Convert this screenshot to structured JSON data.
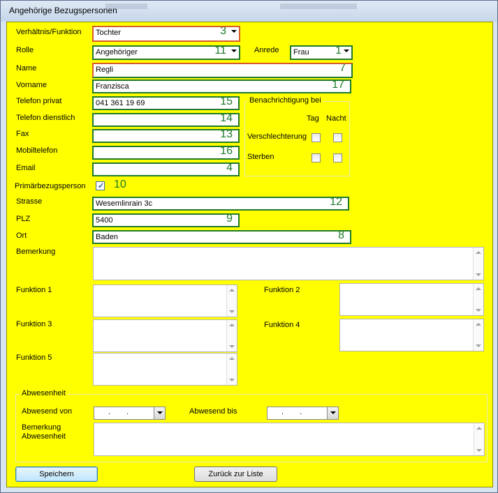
{
  "window": {
    "title": "Angehörige Bezugspersonen"
  },
  "form": {
    "verhaeltnis": {
      "label": "Verhältnis/Funktion",
      "value": "Tochter",
      "num": "3"
    },
    "rolle": {
      "label": "Rolle",
      "value": "Angehöriger",
      "num": "11"
    },
    "anrede": {
      "label": "Anrede",
      "value": "Frau",
      "num": "1"
    },
    "name": {
      "label": "Name",
      "value": "Regli",
      "num": "7"
    },
    "vorname": {
      "label": "Vorname",
      "value": "Franzisca",
      "num": "17"
    },
    "telefon_privat": {
      "label": "Telefon privat",
      "value": "041 361 19 69",
      "num": "15"
    },
    "telefon_dienstlich": {
      "label": "Telefon dienstlich",
      "value": "",
      "num": "14"
    },
    "fax": {
      "label": "Fax",
      "value": "",
      "num": "13"
    },
    "mobiltelefon": {
      "label": "Mobiltelefon",
      "value": "",
      "num": "16"
    },
    "email": {
      "label": "Email",
      "value": "",
      "num": "4"
    },
    "primaer": {
      "label": "Primärbezugsperson",
      "num": "10",
      "checked": true
    },
    "strasse": {
      "label": "Strasse",
      "value": "Wesemlinrain 3c",
      "num": "12"
    },
    "plz": {
      "label": "PLZ",
      "value": "5400",
      "num": "9"
    },
    "ort": {
      "label": "Ort",
      "value": "Baden",
      "num": "8"
    },
    "bemerkung": {
      "label": "Bemerkung"
    },
    "funktion1": {
      "label": "Funktion 1"
    },
    "funktion2": {
      "label": "Funktion 2"
    },
    "funktion3": {
      "label": "Funktion 3"
    },
    "funktion4": {
      "label": "Funktion 4"
    },
    "funktion5": {
      "label": "Funktion 5"
    }
  },
  "benachrichtigung": {
    "title": "Benachrichtigung bei",
    "col_tag": "Tag",
    "col_nacht": "Nacht",
    "rows": [
      {
        "label": "Verschlechterung",
        "tag": false,
        "nacht": false
      },
      {
        "label": "Sterben",
        "tag": false,
        "nacht": false
      }
    ]
  },
  "abwesenheit": {
    "title": "Abwesenheit",
    "von_label": "Abwesend von",
    "bis_label": "Abwesend bis",
    "bemerkung_label_1": "Bemerkung",
    "bemerkung_label_2": "Abwesenheit",
    "date_placeholder": ". ."
  },
  "buttons": {
    "speichern": "Speichern",
    "zurueck": "Zurück zur Liste"
  },
  "colors": {
    "form_bg": "#ffff00",
    "field_border": "#1e7a2a",
    "number_color": "#1e7a2a",
    "accent_border": "#d75b2a"
  }
}
